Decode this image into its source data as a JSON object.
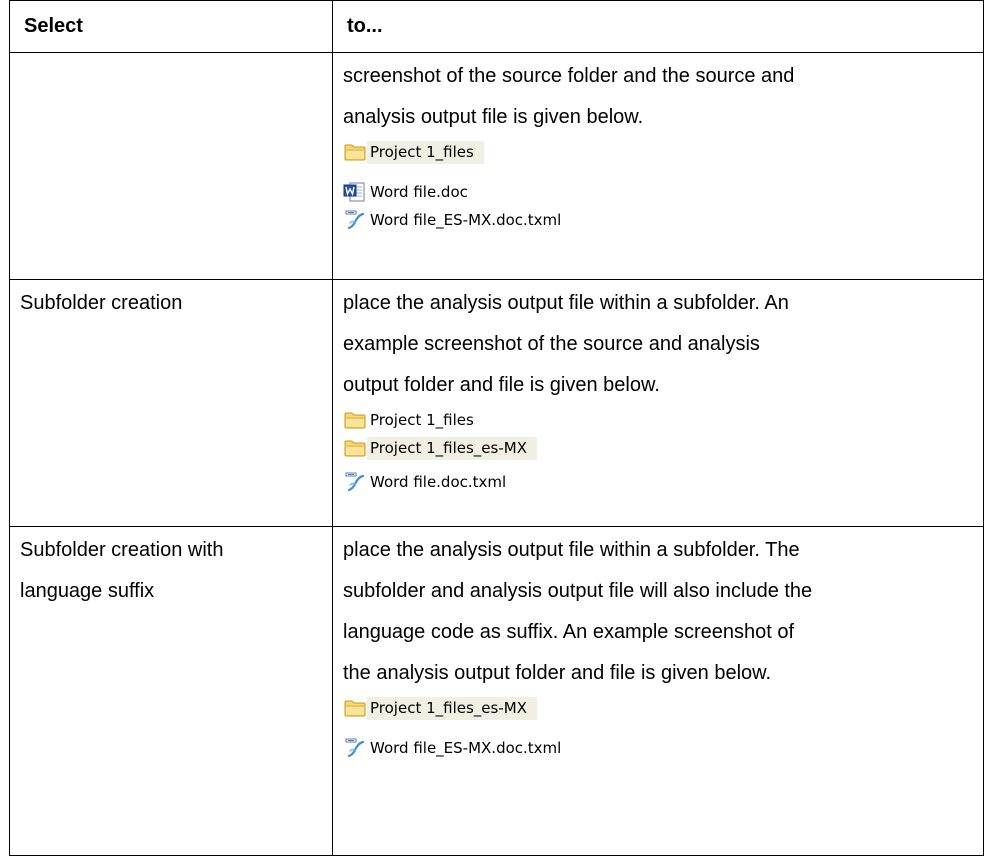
{
  "table": {
    "headers": {
      "select": "Select",
      "to": "to..."
    },
    "rows": [
      {
        "select_lines": [],
        "desc_lines": [
          "screenshot of the source folder and the source and",
          "analysis output file is given below."
        ],
        "folders": [
          "Project 1_files"
        ],
        "files": [
          {
            "name": "Word file.doc",
            "icon": "word-doc-icon"
          },
          {
            "name": "Word file_ES-MX.doc.txml",
            "icon": "txml-file-icon"
          }
        ]
      },
      {
        "select_lines": [
          "Subfolder creation"
        ],
        "desc_lines": [
          "place the analysis output file within a subfolder. An",
          "example screenshot of the source and analysis",
          "output folder and file is given below."
        ],
        "folders": [
          "Project 1_files",
          "Project 1_files_es-MX"
        ],
        "files": [
          {
            "name": "Word file.doc.txml",
            "icon": "txml-file-icon"
          }
        ]
      },
      {
        "select_lines": [
          "Subfolder creation with",
          "language suffix"
        ],
        "desc_lines": [
          "place the analysis output file within a subfolder. The",
          "subfolder and analysis output file will also include the",
          "language code as suffix. An example screenshot of",
          "the analysis output folder and file is given below."
        ],
        "folders": [
          "Project 1_files_es-MX"
        ],
        "files": [
          {
            "name": "Word file_ES-MX.doc.txml",
            "icon": "txml-file-icon"
          }
        ]
      }
    ]
  },
  "colors": {
    "border": "#000000",
    "selection_highlight": "#f1efe2",
    "folder_fill": "#f7d774",
    "folder_stroke": "#c79a1f"
  }
}
